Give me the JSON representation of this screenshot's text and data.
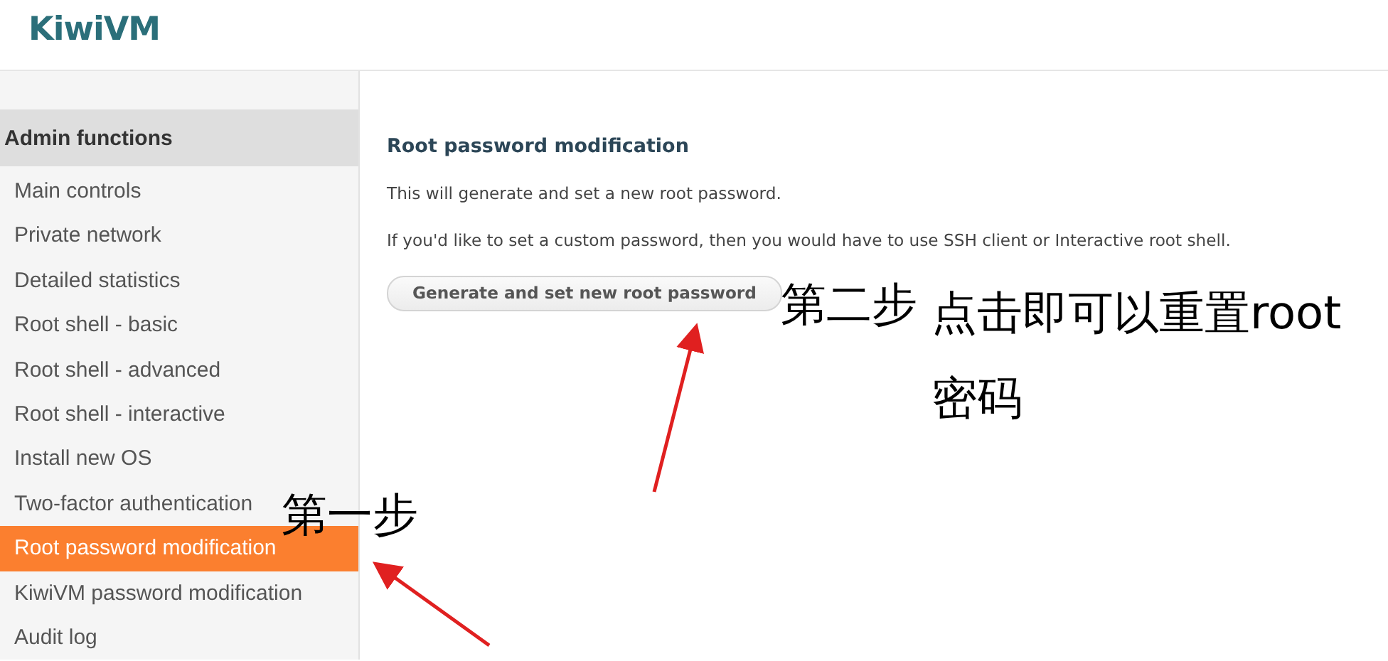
{
  "header": {
    "logo": "KiwiVM"
  },
  "sidebar": {
    "heading": "Admin functions",
    "items": [
      {
        "label": "Main controls",
        "selected": false
      },
      {
        "label": "Private network",
        "selected": false
      },
      {
        "label": "Detailed statistics",
        "selected": false
      },
      {
        "label": "Root shell - basic",
        "selected": false
      },
      {
        "label": "Root shell - advanced",
        "selected": false
      },
      {
        "label": "Root shell - interactive",
        "selected": false
      },
      {
        "label": "Install new OS",
        "selected": false
      },
      {
        "label": "Two-factor authentication",
        "selected": false
      },
      {
        "label": "Root password modification",
        "selected": true
      },
      {
        "label": "KiwiVM password modification",
        "selected": false
      },
      {
        "label": "Audit log",
        "selected": false
      }
    ]
  },
  "main": {
    "title": "Root password modification",
    "paragraphs": [
      "This will generate and set a new root password.",
      "If you'd like to set a custom password, then you would have to use SSH client or Interactive root shell."
    ],
    "button": "Generate and set new root password"
  },
  "annotations": [
    {
      "kind": "step",
      "text": "第一步"
    },
    {
      "kind": "step",
      "text": "第二步"
    },
    {
      "kind": "note",
      "text": "点击即可以重置root密码"
    }
  ]
}
